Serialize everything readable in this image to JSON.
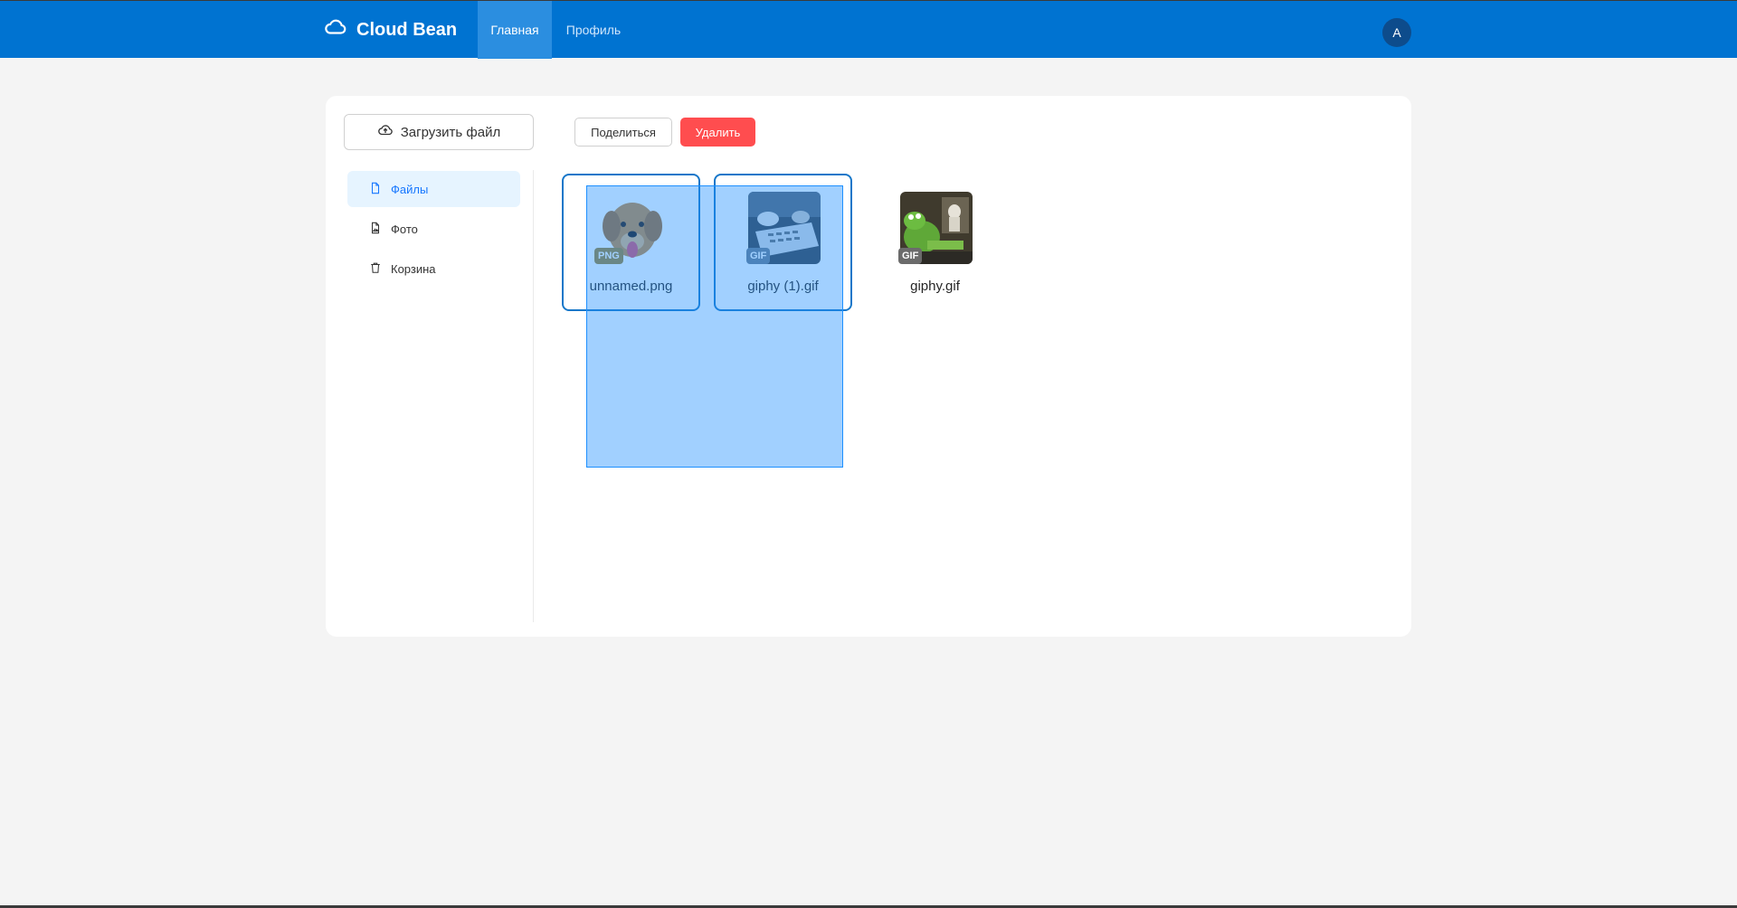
{
  "header": {
    "brand": "Cloud Bean",
    "tabs": [
      {
        "label": "Главная",
        "active": true
      },
      {
        "label": "Профиль",
        "active": false
      }
    ],
    "avatar_initial": "A",
    "accent_color": "#0073d1"
  },
  "toolbar": {
    "upload_label": "Загрузить файл",
    "share_label": "Поделиться",
    "delete_label": "Удалить"
  },
  "sidebar": {
    "items": [
      {
        "label": "Файлы",
        "icon": "file-icon",
        "active": true
      },
      {
        "label": "Фото",
        "icon": "image-file-icon",
        "active": false
      },
      {
        "label": "Корзина",
        "icon": "trash-icon",
        "active": false
      }
    ]
  },
  "files": [
    {
      "name": "unnamed.png",
      "type": "PNG",
      "badge_color": "#a0822f",
      "selected": true,
      "thumb": "dog-photo"
    },
    {
      "name": "giphy (1).gif",
      "type": "GIF",
      "badge_color": "#6b7b8c",
      "selected": true,
      "thumb": "typing-hands-gif"
    },
    {
      "name": "giphy.gif",
      "type": "GIF",
      "badge_color": "#6b6b6b",
      "selected": false,
      "thumb": "kermit-gif"
    }
  ]
}
